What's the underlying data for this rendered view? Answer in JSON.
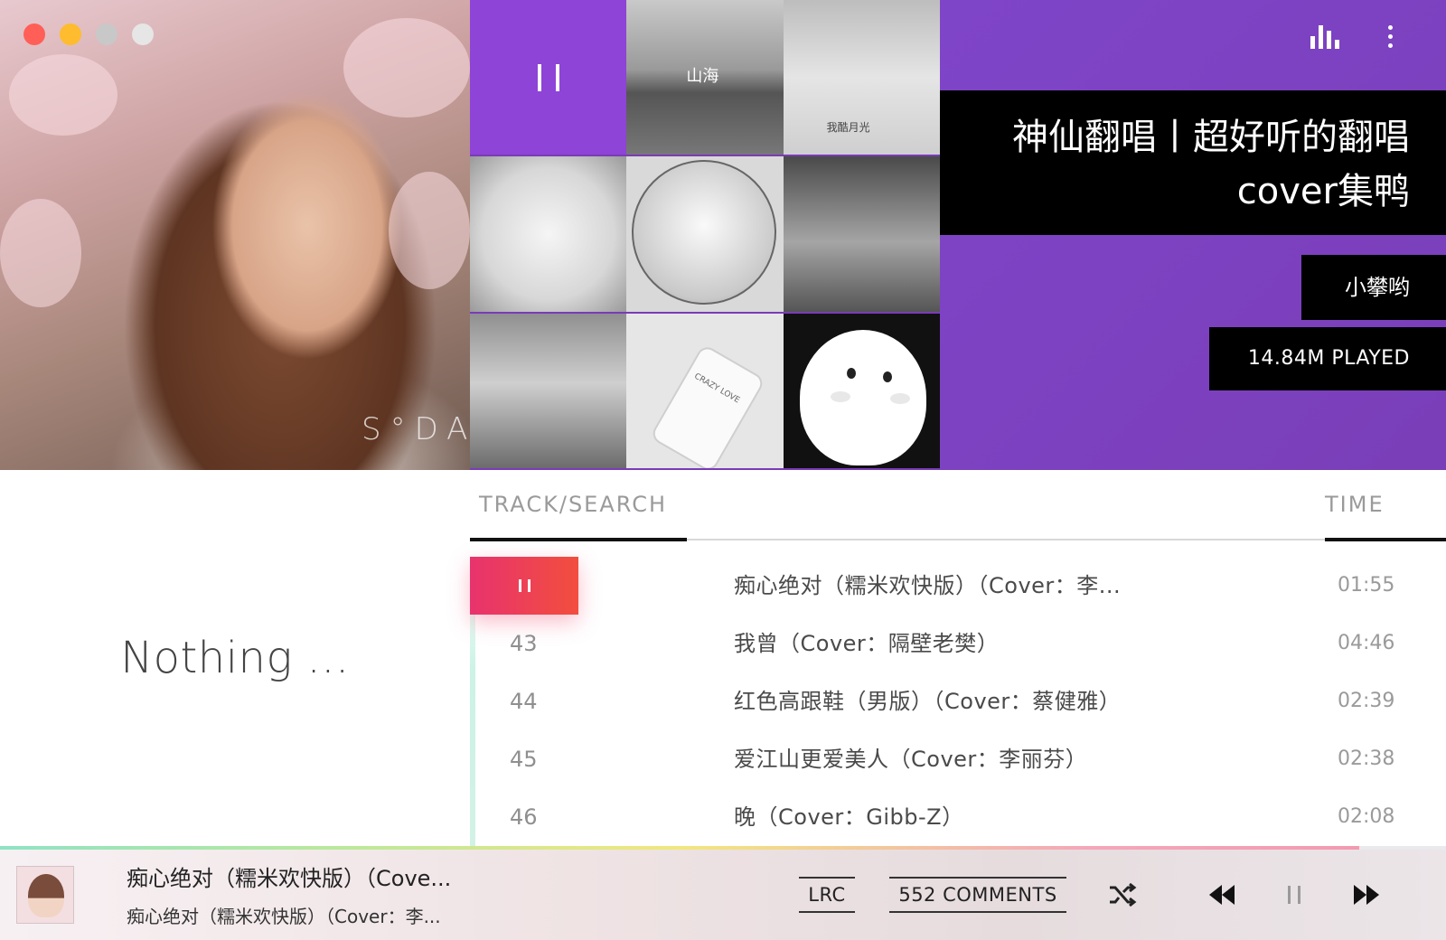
{
  "window": {
    "traffic_lights": [
      {
        "name": "close-dot",
        "color": "#ff5f57"
      },
      {
        "name": "minimize-dot",
        "color": "#febc2e"
      },
      {
        "name": "zoom-dot",
        "color": "#c8c8c8"
      },
      {
        "name": "extra-dot",
        "color": "#e6e6e6"
      }
    ]
  },
  "cover": {
    "watermark": "S°DA"
  },
  "grid": {
    "tiles": [
      {
        "name": "play-tile",
        "icon": "pause-icon"
      },
      {
        "name": "album-shanhai",
        "caption": "山海"
      },
      {
        "name": "album-moonlight",
        "caption": "我酷月光"
      },
      {
        "name": "album-anime-boy"
      },
      {
        "name": "album-anime-girl"
      },
      {
        "name": "album-camera-girl"
      },
      {
        "name": "album-girl-portrait"
      },
      {
        "name": "album-crazy-love",
        "caption": "CRAZY LOVE"
      },
      {
        "name": "album-cartoon-cat"
      }
    ]
  },
  "playlist": {
    "title_line1": "神仙翻唱丨超好听的翻唱",
    "title_line2": "cover集鸭",
    "creator": "小攀哟",
    "played": "14.84M PLAYED",
    "accent_color": "#7f45c9",
    "icons": {
      "equalizer": "equalizer-icon",
      "more": "more-vertical-icon"
    }
  },
  "lyrics": {
    "placeholder": "Nothing  ..."
  },
  "tracklist": {
    "headers": {
      "track": "TRACK/SEARCH",
      "time": "TIME"
    },
    "rows": [
      {
        "num": "",
        "title": "痴心绝对（糯米欢快版）（Cover：李...",
        "time": "01:55",
        "playing": true
      },
      {
        "num": "43",
        "title": "我曾（Cover：隔壁老樊）",
        "time": "04:46"
      },
      {
        "num": "44",
        "title": "红色高跟鞋（男版）（Cover：蔡健雅）",
        "time": "02:39"
      },
      {
        "num": "45",
        "title": "爱江山更爱美人（Cover：李丽芬）",
        "time": "02:38"
      },
      {
        "num": "46",
        "title": "晚（Cover：Gibb-Z）",
        "time": "02:08"
      }
    ]
  },
  "player": {
    "title": "痴心绝对（糯米欢快版）（Cove...",
    "subtitle": "痴心绝对（糯米欢快版）（Cover：李...",
    "lrc_label": "LRC",
    "comments_label": "552 COMMENTS",
    "progress": 0.94,
    "icons": {
      "shuffle": "shuffle-icon",
      "previous": "rewind-icon",
      "pause": "pause-icon",
      "next": "fast-forward-icon"
    }
  }
}
